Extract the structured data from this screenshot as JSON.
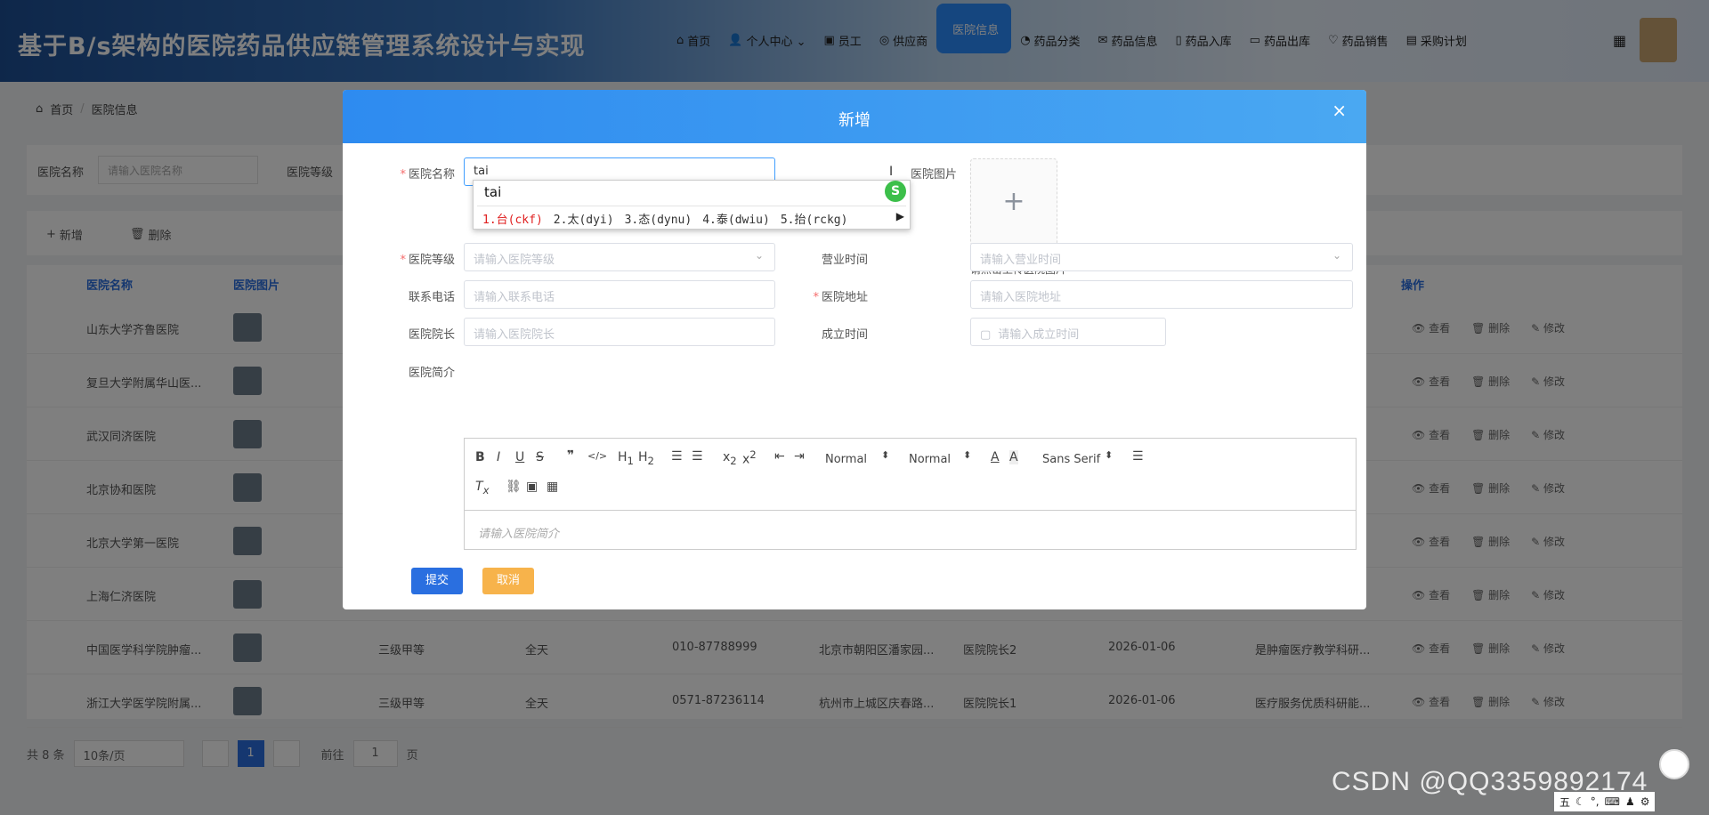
{
  "header": {
    "title": "基于B/s架构的医院药品供应链管理系统设计与实现",
    "nav": [
      {
        "icon": "home-icon",
        "glyph": "⌂",
        "label": "首页"
      },
      {
        "icon": "user-icon",
        "glyph": "👤",
        "label": "个人中心 ⌄"
      },
      {
        "icon": "staff-icon",
        "glyph": "▣",
        "label": "员工"
      },
      {
        "icon": "supplier-icon",
        "glyph": "◎",
        "label": "供应商"
      },
      {
        "icon": "hospital-icon",
        "glyph": "",
        "label": "医院信息"
      },
      {
        "icon": "category-icon",
        "glyph": "◔",
        "label": "药品分类"
      },
      {
        "icon": "mail-icon",
        "glyph": "✉",
        "label": "药品信息"
      },
      {
        "icon": "inbound-icon",
        "glyph": "▯",
        "label": "药品入库"
      },
      {
        "icon": "outbound-icon",
        "glyph": "▭",
        "label": "药品出库"
      },
      {
        "icon": "sales-icon",
        "glyph": "♡",
        "label": "药品销售"
      },
      {
        "icon": "plan-icon",
        "glyph": "▤",
        "label": "采购计划"
      }
    ]
  },
  "breadcrumb": {
    "home": "首页",
    "sep": "/",
    "current": "医院信息"
  },
  "filters": {
    "name_label": "医院名称",
    "name_placeholder": "请输入医院名称",
    "level_label": "医院等级"
  },
  "toolbar": {
    "add": "新增",
    "delete": "删除"
  },
  "table": {
    "headers": {
      "name": "医院名称",
      "image": "医院图片",
      "ops": "操作"
    },
    "ops": {
      "view": "查看",
      "delete": "删除",
      "edit": "修改"
    },
    "rows": [
      {
        "name": "山东大学齐鲁医院"
      },
      {
        "name": "复旦大学附属华山医..."
      },
      {
        "name": "武汉同济医院"
      },
      {
        "name": "北京协和医院"
      },
      {
        "name": "北京大学第一医院"
      },
      {
        "name": "上海仁济医院"
      },
      {
        "name": "中国医学科学院肿瘤...",
        "level": "三级甲等",
        "hours": "全天",
        "phone": "010-87788999",
        "addr": "北京市朝阳区潘家园...",
        "president": "医院院长2",
        "date": "2026-01-06",
        "intro": "是肿瘤医疗教学科研..."
      },
      {
        "name": "浙江大学医学院附属...",
        "level": "三级甲等",
        "hours": "全天",
        "phone": "0571-87236114",
        "addr": "杭州市上城区庆春路...",
        "president": "医院院长1",
        "date": "2026-01-06",
        "intro": "医疗服务优质科研能..."
      }
    ]
  },
  "pager": {
    "total": "共 8 条",
    "size": "10条/页",
    "page": "1",
    "goto": "前往",
    "page_input": "1",
    "page_unit": "页"
  },
  "modal": {
    "title": "新增",
    "close": "×",
    "name_label": "医院名称",
    "name_value": "tai",
    "image_label": "医院图片",
    "upload_plus": "+",
    "upload_tip": "请点击上传医院图片",
    "level_label": "医院等级",
    "level_placeholder": "请输入医院等级",
    "hours_label": "营业时间",
    "hours_placeholder": "请输入营业时间",
    "phone_label": "联系电话",
    "phone_placeholder": "请输入联系电话",
    "address_label": "医院地址",
    "address_placeholder": "请输入医院地址",
    "president_label": "医院院长",
    "president_placeholder": "请输入医院院长",
    "founded_label": "成立时间",
    "founded_placeholder": "请输入成立时间",
    "intro_label": "医院简介",
    "intro_placeholder": "请输入医院简介",
    "submit": "提交",
    "cancel": "取消"
  },
  "ime": {
    "composition": "tai",
    "candidates": [
      "1.台(ckf)",
      "2.太(dyi)",
      "3.态(dynu)",
      "4.泰(dwiu)",
      "5.抬(rckg)"
    ],
    "logo": "S"
  },
  "editor": {
    "header_select": "Normal",
    "size_select": "Normal",
    "font_select": "Sans Serif"
  },
  "watermark": "CSDN @QQ3359892174",
  "tray": "五"
}
